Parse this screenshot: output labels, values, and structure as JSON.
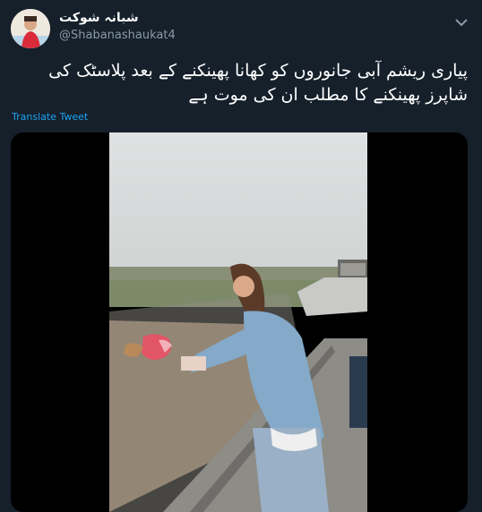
{
  "author": {
    "display_name": "شبانہ شوکت",
    "handle": "@Shabanashaukat4"
  },
  "tweet": {
    "text": "پیاری ریشم آبی جانوروں کو کھانا پھینکنے کے بعد پلاسٹک کی شاپرز پھینکنے کا مطلب ان کی موت ہے",
    "translate_label": "Translate Tweet"
  },
  "icons": {
    "more": "more-options-icon"
  },
  "colors": {
    "background": "#15202b",
    "link": "#1da1f2",
    "secondary_text": "#8899a6"
  }
}
